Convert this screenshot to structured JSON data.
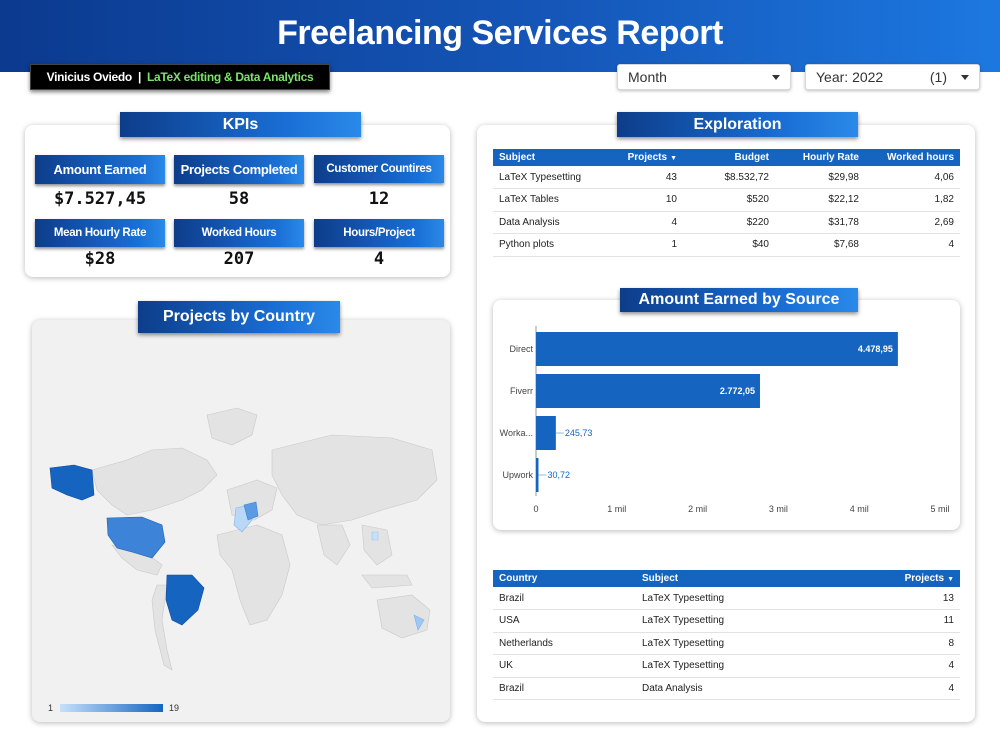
{
  "header": {
    "title": "Freelancing Services Report"
  },
  "author": {
    "name": "Vinicius Oviedo",
    "separator": "|",
    "tagline": "LaTeX editing & Data Analytics"
  },
  "filters": {
    "month": {
      "label": "Month"
    },
    "year": {
      "label": "Year: 2022",
      "count": "(1)"
    }
  },
  "kpis": {
    "title": "KPIs",
    "items": [
      {
        "label": "Amount Earned",
        "value": "$7.527,45"
      },
      {
        "label": "Projects Completed",
        "value": "58"
      },
      {
        "label": "Customer Countires",
        "value": "12"
      },
      {
        "label": "Mean Hourly Rate",
        "value": "$28"
      },
      {
        "label": "Worked Hours",
        "value": "207"
      },
      {
        "label": "Hours/Project",
        "value": "4"
      }
    ]
  },
  "map": {
    "title": "Projects by Country",
    "legend_min": "1",
    "legend_max": "19",
    "colors": {
      "low": "#c6e0fb",
      "high": "#1565c0",
      "land": "#e3e3e3"
    },
    "highlighted_countries": [
      "Brazil",
      "USA",
      "Netherlands",
      "UK"
    ]
  },
  "exploration": {
    "title": "Exploration",
    "columns": [
      "Subject",
      "Projects",
      "Budget",
      "Hourly Rate",
      "Worked hours"
    ],
    "rows": [
      [
        "LaTeX Typesetting",
        "43",
        "$8.532,72",
        "$29,98",
        "4,06"
      ],
      [
        "LaTeX Tables",
        "10",
        "$520",
        "$22,12",
        "1,82"
      ],
      [
        "Data Analysis",
        "4",
        "$220",
        "$31,78",
        "2,69"
      ],
      [
        "Python plots",
        "1",
        "$40",
        "$7,68",
        "4"
      ]
    ]
  },
  "chart_data": {
    "type": "bar",
    "orientation": "horizontal",
    "title": "Amount Earned by Source",
    "categories": [
      "Direct",
      "Fiverr",
      "Worka...",
      "Upwork"
    ],
    "values": [
      4478.95,
      2772.05,
      245.73,
      30.72
    ],
    "value_labels": [
      "4.478,95",
      "2.772,05",
      "245,73",
      "30,72"
    ],
    "xticks": [
      "0",
      "1 mil",
      "2 mil",
      "3 mil",
      "4 mil",
      "5 mil"
    ],
    "xlim": [
      0,
      5000
    ],
    "color": "#1565c0",
    "grid": false
  },
  "country_table": {
    "columns": [
      "Country",
      "Subject",
      "Projects"
    ],
    "rows": [
      [
        "Brazil",
        "LaTeX Typesetting",
        "13"
      ],
      [
        "USA",
        "LaTeX Typesetting",
        "11"
      ],
      [
        "Netherlands",
        "LaTeX Typesetting",
        "8"
      ],
      [
        "UK",
        "LaTeX Typesetting",
        "4"
      ],
      [
        "Brazil",
        "Data Analysis",
        "4"
      ]
    ]
  }
}
